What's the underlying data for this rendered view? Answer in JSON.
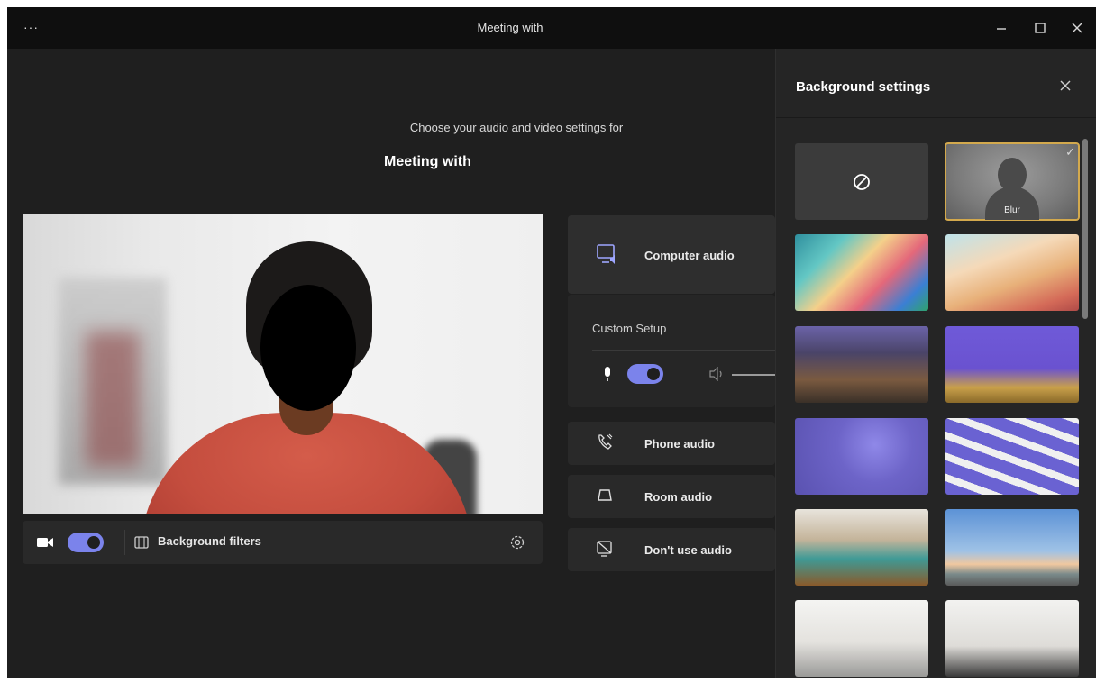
{
  "window": {
    "menu_glyph": "···",
    "title": "Meeting with",
    "controls": [
      "minimize-icon",
      "maximize-icon",
      "close-icon"
    ]
  },
  "prejoin": {
    "prompt": "Choose your audio and video settings for",
    "meeting_name": "Meeting with"
  },
  "video": {
    "camera_on": true,
    "background_filters_label": "Background filters"
  },
  "audio": {
    "computer_audio_label": "Computer audio",
    "custom_setup_label": "Custom Setup",
    "mic_on": true,
    "phone_audio_label": "Phone audio",
    "room_audio_label": "Room audio",
    "no_audio_label": "Don't use audio"
  },
  "background_settings": {
    "title": "Background settings",
    "selected": "Blur",
    "blur_label": "Blur",
    "tiles": [
      "none",
      "blur",
      "abstract-waves",
      "pastel-sculpture",
      "living-room",
      "purple-office",
      "blue-dots",
      "sticky-notes-wall",
      "modern-office",
      "seaside-town",
      "white-room",
      "white-loft"
    ]
  },
  "colors": {
    "accent": "#7b83eb",
    "selected_outline": "#d3a94d",
    "titlebar": "#0f0f0f",
    "background": "#1f1f1f"
  }
}
